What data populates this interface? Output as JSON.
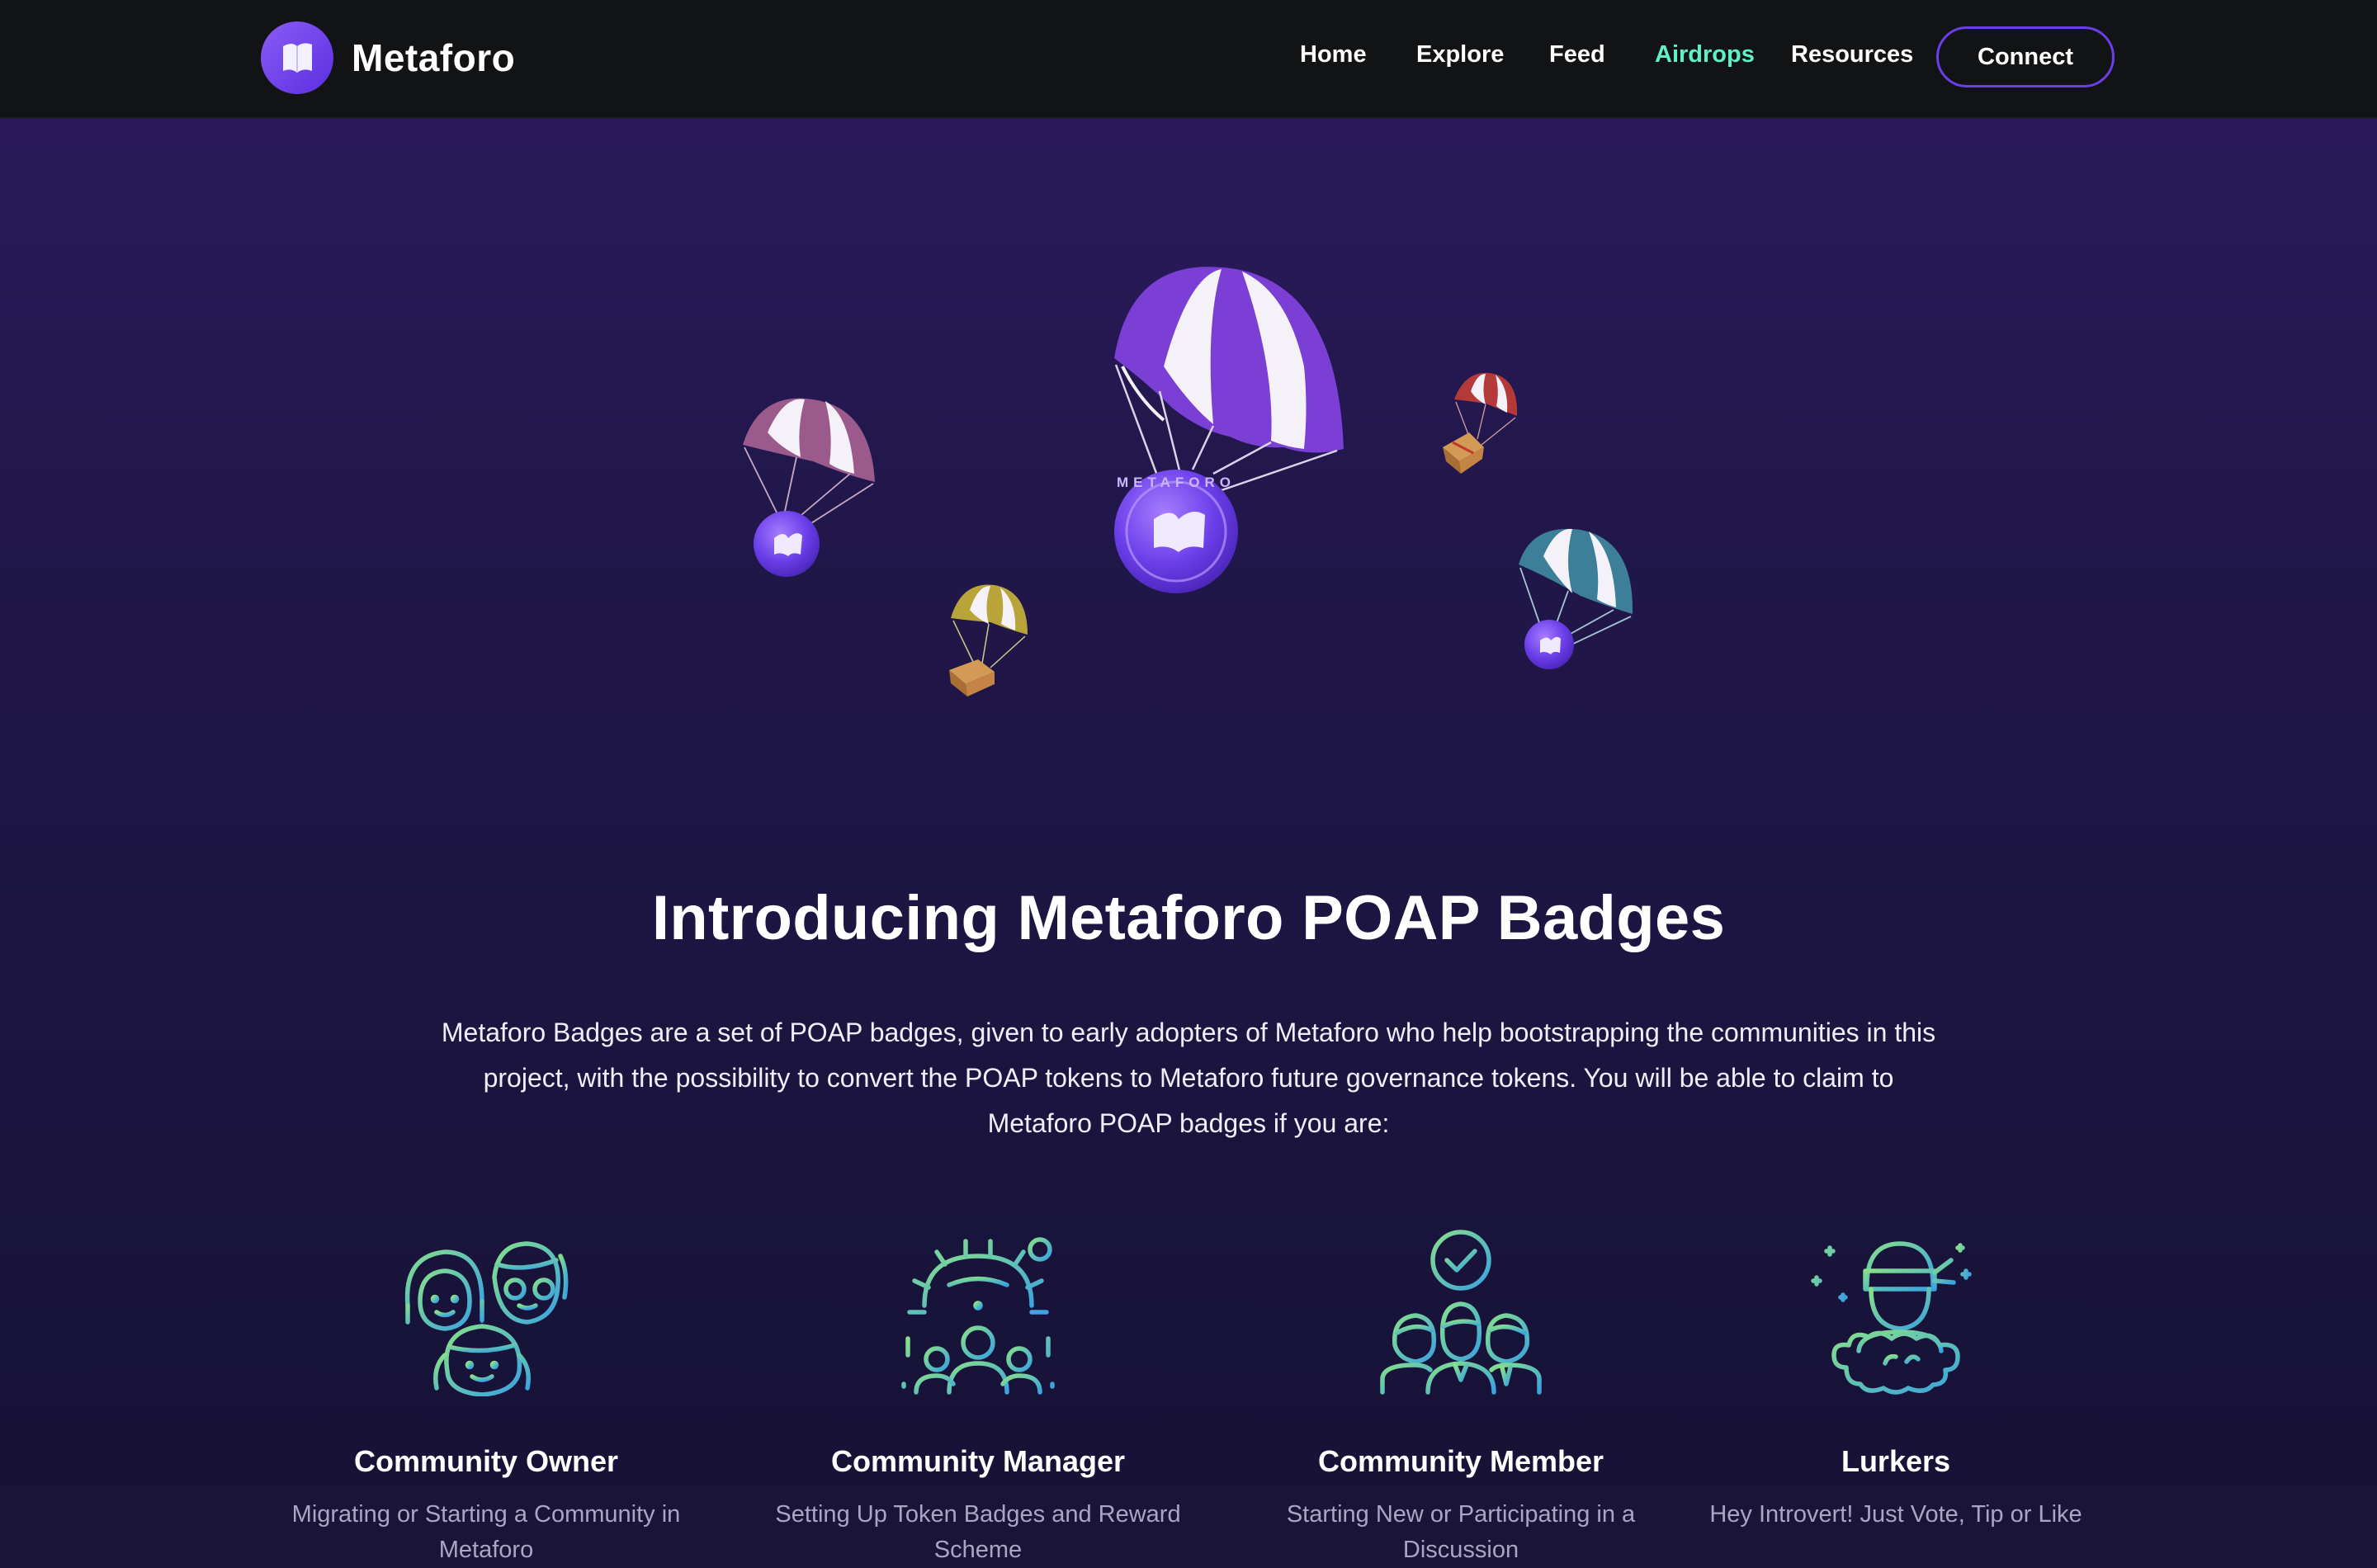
{
  "brand": {
    "name": "Metaforo"
  },
  "nav": {
    "links": [
      {
        "label": "Home",
        "active": false
      },
      {
        "label": "Explore",
        "active": false
      },
      {
        "label": "Feed",
        "active": false
      },
      {
        "label": "Airdrops",
        "active": true
      },
      {
        "label": "Resources",
        "active": false
      }
    ],
    "connect_label": "Connect"
  },
  "hero": {
    "coin_text": "METAFORO",
    "title": "Introducing Metaforo POAP Badges",
    "intro": "Metaforo Badges are a set of POAP badges, given to early adopters of Metaforo who help bootstrapping the communities in this project, with the possibility to convert the POAP tokens to Metaforo future governance tokens. You will be able to claim to Metaforo POAP badges if you are:"
  },
  "roles": [
    {
      "title": "Community Owner",
      "desc": "Migrating or Starting a Community in Metaforo",
      "icon": "community-owner-icon"
    },
    {
      "title": "Community Manager",
      "desc": "Setting Up Token Badges and Reward Scheme",
      "icon": "community-manager-icon"
    },
    {
      "title": "Community Member",
      "desc": "Starting New or Participating in a Discussion",
      "icon": "community-member-icon"
    },
    {
      "title": "Lurkers",
      "desc": "Hey Introvert! Just Vote, Tip or Like",
      "icon": "lurker-icon"
    }
  ],
  "colors": {
    "accent": "#6a3ee8",
    "active_link": "#5ff0c8",
    "nav_bg": "#121315",
    "hero_top": "#2a1a5c",
    "icon_gradient": [
      "#7ee08a",
      "#3aa7e0"
    ]
  }
}
